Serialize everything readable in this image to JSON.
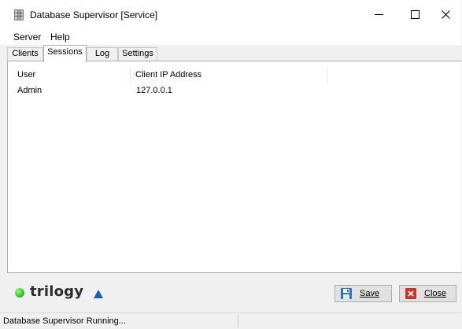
{
  "window": {
    "title": "Database Supervisor [Service]",
    "icons": {
      "app": "database-icon",
      "minimize": "minimize-icon",
      "maximize": "maximize-icon",
      "close": "close-icon"
    }
  },
  "menu": {
    "items": [
      "Server",
      "Help"
    ]
  },
  "tabs": {
    "items": [
      "Clients",
      "Sessions",
      "Log",
      "Settings"
    ],
    "active": "Sessions"
  },
  "sessions": {
    "columns": [
      "User",
      "Client IP Address"
    ],
    "rows": [
      {
        "user": "Admin",
        "ip": "127.0.0.1"
      }
    ]
  },
  "brand": {
    "name": "trilogy",
    "indicator_color": "#2fc42a",
    "accent_color": "#1a5fb4"
  },
  "buttons": {
    "save": {
      "label": "Save",
      "icon": "floppy-disk-icon"
    },
    "close": {
      "label": "Close",
      "icon": "red-x-icon"
    }
  },
  "status": {
    "text": "Database Supervisor Running..."
  }
}
